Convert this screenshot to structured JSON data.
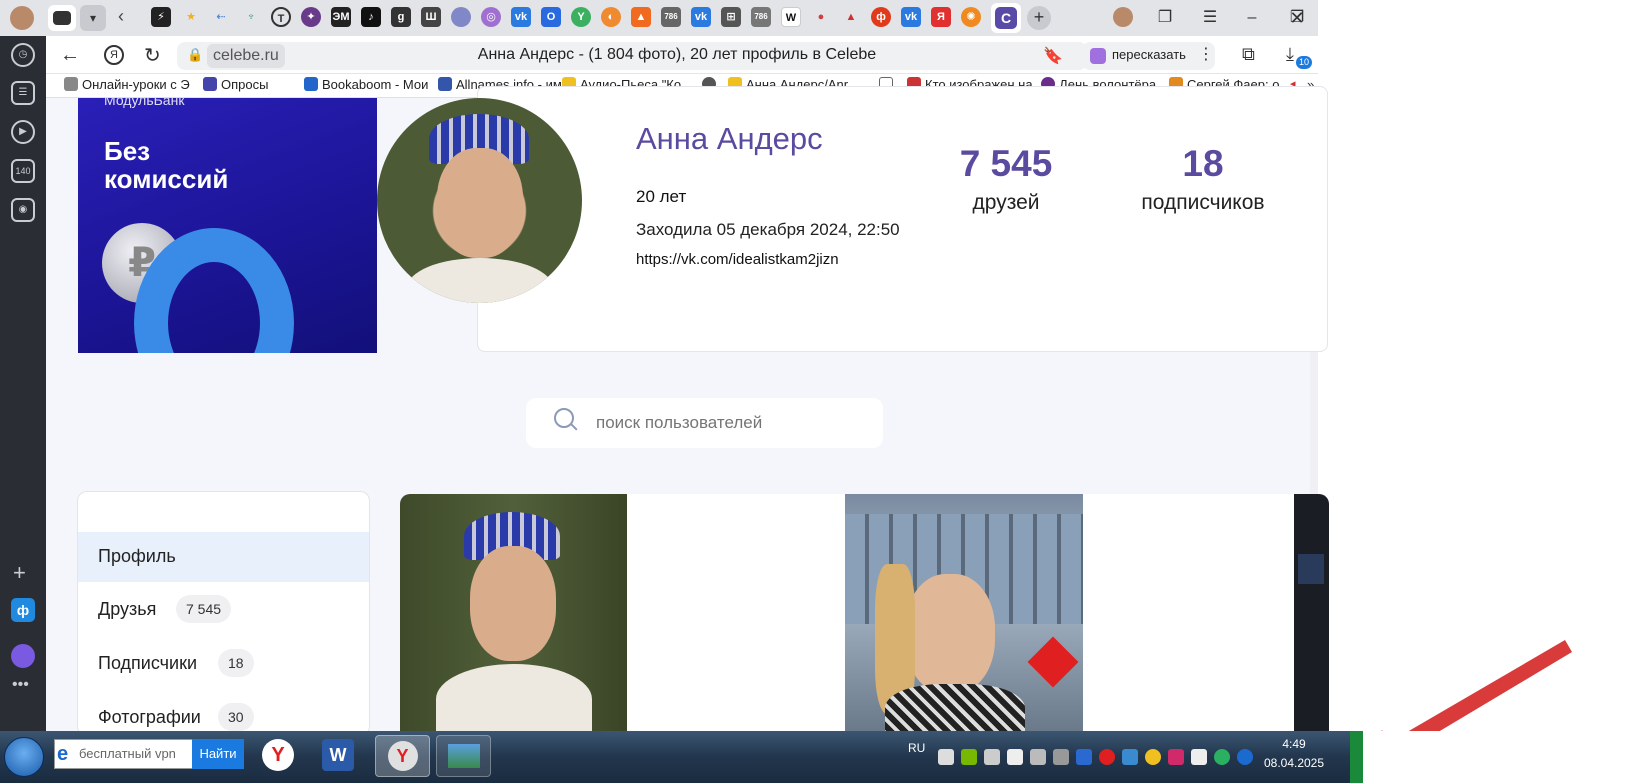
{
  "browser": {
    "page_title": "Анна Андерс - (1 804 фото), 20 лет профиль в Celebe",
    "url": "celebe.ru",
    "retell_label": "пересказать",
    "downloads_count": "10",
    "bookmarks": [
      {
        "label": "Онлайн-уроки с Э",
        "color": "#888888"
      },
      {
        "label": "Опросы",
        "color": "#4444aa"
      },
      {
        "label": "Bookaboom - Мои",
        "color": "#2266cc"
      },
      {
        "label": "Allnames.info - им",
        "color": "#3355aa"
      },
      {
        "label": "Аудио-Пьеса \"Ко",
        "color": "#f0c020"
      },
      {
        "label": "",
        "color": "#555555"
      },
      {
        "label": "Анна Андерс/Anr",
        "color": "#f0c020"
      },
      {
        "label": "",
        "color": "#666666"
      },
      {
        "label": "Кто изображен на",
        "color": "#cc3333"
      },
      {
        "label": "День волонтёра",
        "color": "#6a2d8a"
      },
      {
        "label": "Сергей Фаер: о",
        "color": "#e08a20"
      }
    ]
  },
  "ad": {
    "brand": "МодульБанк",
    "headline_1": "Без",
    "headline_2": "комиссий"
  },
  "profile": {
    "name": "Анна Андерс",
    "age": "20 лет",
    "last_seen": "Заходила 05 декабря 2024, 22:50",
    "link": "https://vk.com/idealistkam2jizn",
    "friends_count": "7 545",
    "friends_label": "друзей",
    "followers_count": "18",
    "followers_label": "подписчиков"
  },
  "search": {
    "placeholder": "поиск пользователей"
  },
  "menu": {
    "items": [
      {
        "label": "Профиль",
        "badge": ""
      },
      {
        "label": "Друзья",
        "badge": "7 545"
      },
      {
        "label": "Подписчики",
        "badge": "18"
      },
      {
        "label": "Фотографии",
        "badge": "30"
      }
    ]
  },
  "taskbar": {
    "search_placeholder": "бесплатный vpn",
    "search_button": "Найти",
    "lang": "RU",
    "time": "4:49",
    "date": "08.04.2025"
  }
}
